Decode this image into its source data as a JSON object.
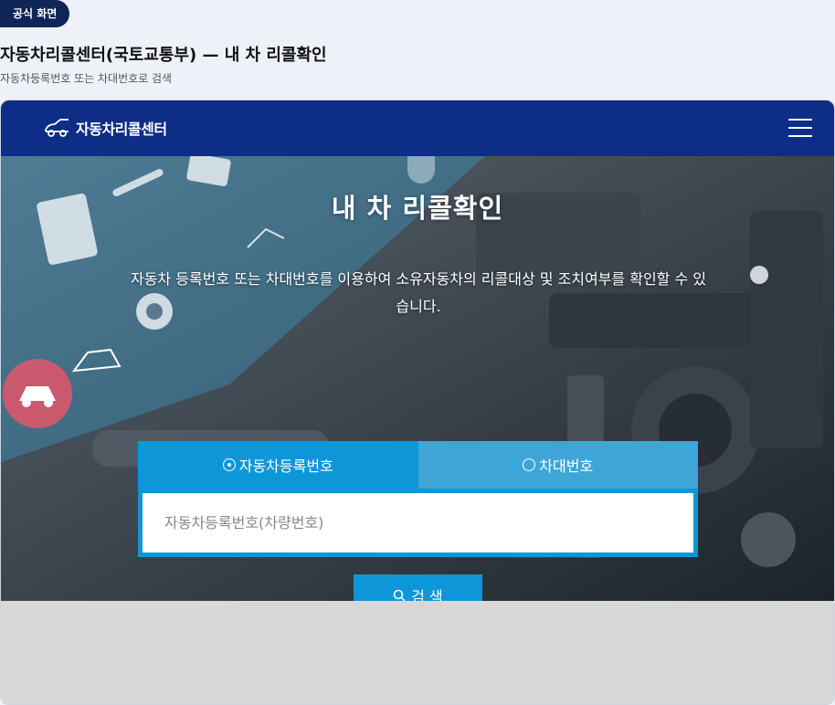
{
  "badge": "공식 화면",
  "page": {
    "title": "자동차리콜센터(국토교통부) — 내 차 리콜확인",
    "subtitle": "자동차등록번호 또는 차대번호로 검색"
  },
  "nav": {
    "logo_text": "자동차리콜센터",
    "menu_icon": "hamburger-menu-icon"
  },
  "hero": {
    "title": "내 차 리콜확인",
    "description": "자동차 등록번호 또는 차대번호를 이용하여 소유자동차의 리콜대상 및 조치여부를 확인할 수 있습니다."
  },
  "search": {
    "tabs": [
      {
        "label": "자동차등록번호",
        "selected": true
      },
      {
        "label": "차대번호",
        "selected": false
      }
    ],
    "placeholder": "자동차등록번호(차량번호)",
    "value": "",
    "button_label": "검 색",
    "button_icon": "search-icon"
  },
  "colors": {
    "nav": "#0d2d86",
    "accent": "#0d97d9",
    "tab_inactive": "#3ea6d6",
    "badge": "#0f2557"
  }
}
